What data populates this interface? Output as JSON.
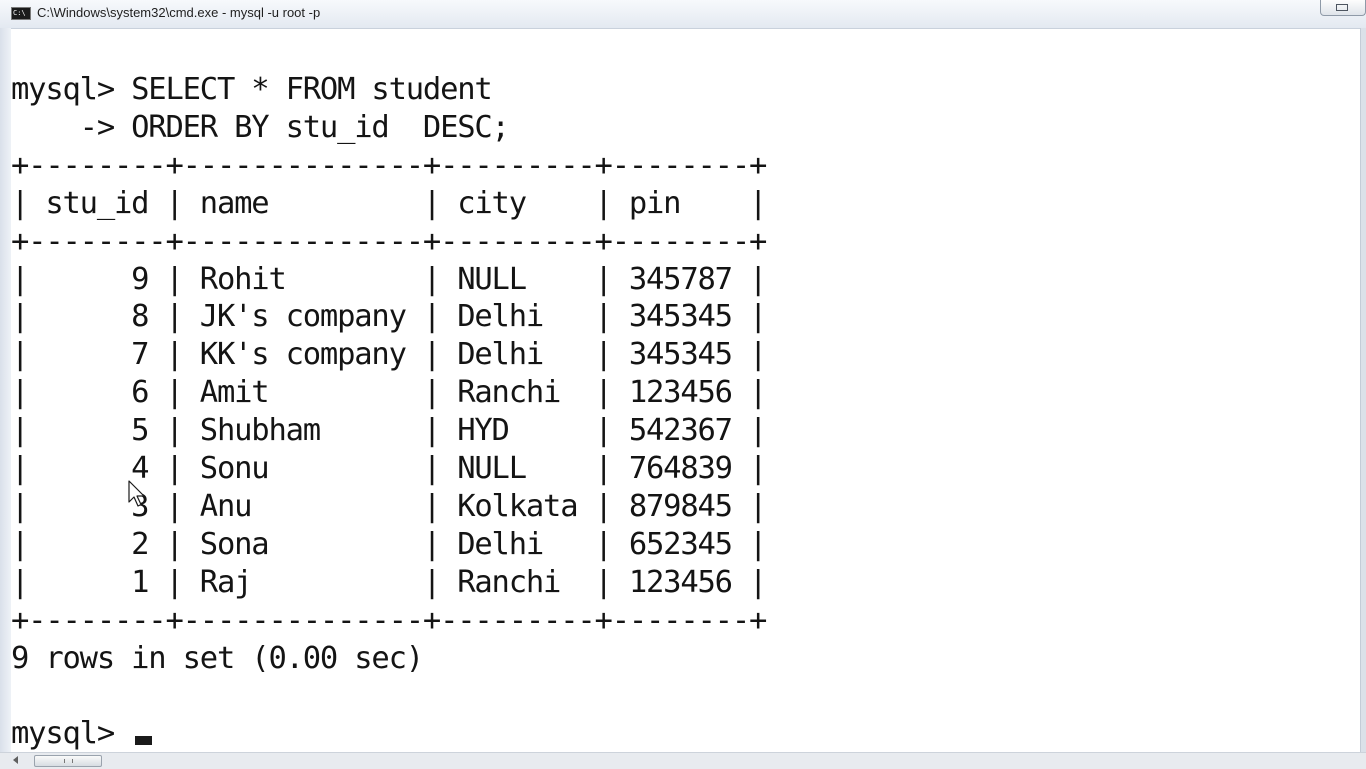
{
  "window": {
    "title": "C:\\Windows\\system32\\cmd.exe - mysql  -u root -p",
    "icon": "cmd-icon",
    "icon_text": "C:\\",
    "buttons": [
      "minimize-button"
    ]
  },
  "console": {
    "lines": [
      "mysql> SELECT * FROM student",
      "    -> ORDER BY stu_id  DESC;",
      "+--------+--------------+---------+--------+",
      "| stu_id | name         | city    | pin    |",
      "+--------+--------------+---------+--------+",
      "|      9 | Rohit        | NULL    | 345787 |",
      "|      8 | JK's company | Delhi   | 345345 |",
      "|      7 | KK's company | Delhi   | 345345 |",
      "|      6 | Amit         | Ranchi  | 123456 |",
      "|      5 | Shubham      | HYD     | 542367 |",
      "|      4 | Sonu         | NULL    | 764839 |",
      "|      3 | Anu          | Kolkata | 879845 |",
      "|      2 | Sona         | Delhi   | 652345 |",
      "|      1 | Raj          | Ranchi  | 123456 |",
      "+--------+--------------+---------+--------+",
      "9 rows in set (0.00 sec)",
      "",
      "mysql> "
    ]
  },
  "colors": {
    "background": "#ffffff",
    "text": "#141414",
    "titlebar": "#e3e9f1"
  }
}
